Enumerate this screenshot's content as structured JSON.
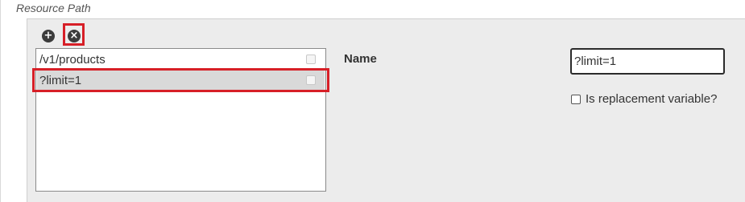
{
  "section": {
    "title": "Resource Path"
  },
  "toolbar": {
    "add_icon": "plus-circle-icon",
    "remove_icon": "x-circle-icon",
    "add_glyph": "+",
    "remove_glyph": "×"
  },
  "list": {
    "items": [
      {
        "label": "/v1/products",
        "selected": false
      },
      {
        "label": "?limit=1",
        "selected": true
      }
    ]
  },
  "details": {
    "name_label": "Name",
    "name_value": "?limit=1",
    "replacement_label": "Is replacement variable?",
    "replacement_checked": false
  },
  "colors": {
    "highlight": "#d71f27",
    "panel_bg": "#ececec",
    "selected_row_bg": "#d9d9d9"
  }
}
